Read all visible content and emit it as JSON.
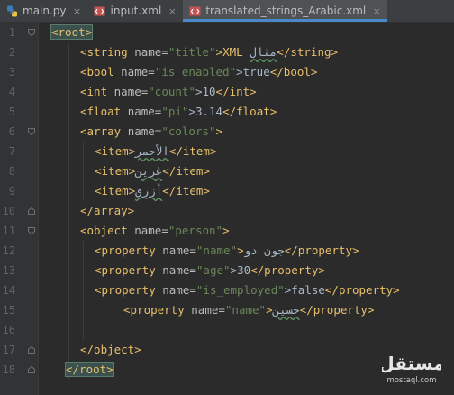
{
  "tabs": [
    {
      "label": "main.py",
      "icon": "python-file-icon",
      "active": false
    },
    {
      "label": "input.xml",
      "icon": "xml-file-icon",
      "active": false
    },
    {
      "label": "translated_strings_Arabic.xml",
      "icon": "xml-file-icon",
      "active": true
    }
  ],
  "tab_close_glyph": "×",
  "line_numbers": [
    "1",
    "2",
    "3",
    "4",
    "5",
    "6",
    "7",
    "8",
    "9",
    "10",
    "11",
    "12",
    "13",
    "14",
    "15",
    "16",
    "17",
    "18"
  ],
  "code": {
    "l1": {
      "open": "<root>"
    },
    "l2": {
      "a": "<string ",
      "b": "name=",
      "c": "\"title\"",
      "d": ">XML ",
      "e": "مثال",
      "f": "</string>"
    },
    "l3": {
      "a": "<bool ",
      "b": "name=",
      "c": "\"is_enabled\"",
      "d": ">true",
      "f": "</bool>"
    },
    "l4": {
      "a": "<int ",
      "b": "name=",
      "c": "\"count\"",
      "d": ">10",
      "f": "</int>"
    },
    "l5": {
      "a": "<float ",
      "b": "name=",
      "c": "\"pi\"",
      "d": ">3.14",
      "f": "</float>"
    },
    "l6": {
      "a": "<array ",
      "b": "name=",
      "c": "\"colors\"",
      "d": ">"
    },
    "l7": {
      "a": "<item>",
      "e": "الأحمر",
      "f": "</item>"
    },
    "l8": {
      "a": "<item>",
      "e": "غرين",
      "f": "</item>"
    },
    "l9": {
      "a": "<item>",
      "e": "أزرق",
      "f": "</item>"
    },
    "l10": {
      "f": "</array>"
    },
    "l11": {
      "a": "<object ",
      "b": "name=",
      "c": "\"person\"",
      "d": ">"
    },
    "l12": {
      "a": "<property ",
      "b": "name=",
      "c": "\"name\"",
      "d": ">",
      "e": "جون دو",
      "f": "</property>"
    },
    "l13": {
      "a": "<property ",
      "b": "name=",
      "c": "\"age\"",
      "d": ">30",
      "f": "</property>"
    },
    "l14": {
      "a": "<property ",
      "b": "name=",
      "c": "\"is_employed\"",
      "d": ">false",
      "f": "</property>"
    },
    "l15": {
      "a": "<property ",
      "b": "name=",
      "c": "\"name\"",
      "d": ">",
      "e": "حسين",
      "f": "</property>"
    },
    "l17": {
      "f": "</object>"
    },
    "l18": {
      "close": "</root>"
    }
  },
  "watermark": {
    "logo_text": "مستقل",
    "domain": "mostaql.com"
  },
  "colors": {
    "editor_bg": "#2b2b2b",
    "gutter_bg": "#313335",
    "tag": "#e8bf6a",
    "attr": "#bababa",
    "value": "#6a8759",
    "text": "#a9b7c6",
    "tab_underline": "#4a88c7",
    "bulb": "#f0a732"
  }
}
